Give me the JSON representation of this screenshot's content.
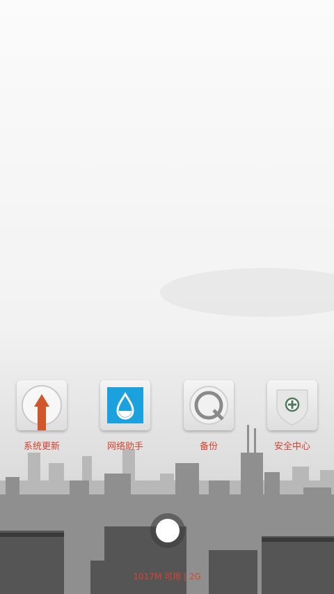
{
  "colors": {
    "label": "#d9432f",
    "update_arrow": "#d1562a",
    "network_blue": "#1aa1de",
    "security_green": "#4e7a5b"
  },
  "apps": [
    {
      "label": "系统更新",
      "icon": "update-arrow-icon"
    },
    {
      "label": "网络助手",
      "icon": "water-drop-icon"
    },
    {
      "label": "备份",
      "icon": "backup-dial-icon"
    },
    {
      "label": "安全中心",
      "icon": "shield-plus-icon"
    }
  ],
  "status": {
    "memory": "1017M 可用",
    "separator": "|",
    "network": "2G"
  },
  "bottom": {
    "home_icon": "home-circle-icon"
  }
}
